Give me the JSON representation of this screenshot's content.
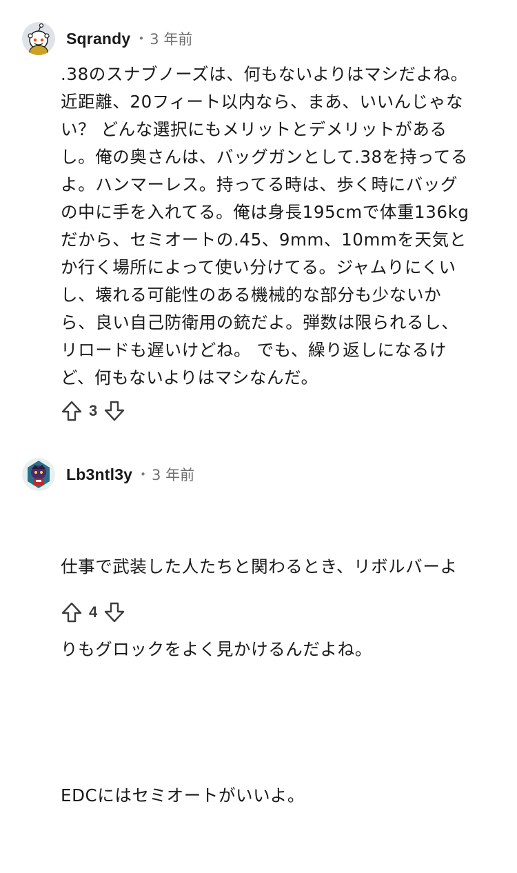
{
  "comments": [
    {
      "username": "Sqrandy",
      "separator": "•",
      "time": "3 年前",
      "avatar_icon": "snoo-avatar-icon",
      "lines": [
        ".38のスナブノーズは、何もないよりはマシだよね。",
        "近距離、20フィート以内なら、まあ、いいんじゃな",
        "い？ どんな選択にもメリットとデメリットがある",
        "し。俺の奥さんは、バッグガンとして.38を持ってる",
        "よ。ハンマーレス。持ってる時は、歩く時にバッグ",
        "の中に手を入れてる。俺は身長195cmで体重136kg",
        "だから、セミオートの.45、9mm、10mmを天気と",
        "か行く場所によって使い分けてる。ジャムりにくい",
        "し、壊れる可能性のある機械的な部分も少ないか",
        "ら、良い自己防衛用の銃だよ。弾数は限られるし、",
        "リロードも遅いけどね。 でも、繰り返しになるけ",
        "ど、何もないよりはマシなんだ。"
      ],
      "score": "3",
      "upvote_icon": "upvote-arrow-icon",
      "downvote_icon": "downvote-arrow-icon"
    },
    {
      "username": "Lb3ntl3y",
      "separator": "•",
      "time": "3 年前",
      "avatar_icon": "character-avatar-icon",
      "paragraphs": [
        [
          "仕事で武装した人たちと関わるとき、リボルバーよ",
          "りもグロックをよく見かけるんだよね。"
        ],
        [
          "EDCにはセミオートがいいよ。"
        ]
      ],
      "score": "4",
      "upvote_icon": "upvote-arrow-icon",
      "downvote_icon": "downvote-arrow-icon"
    }
  ],
  "colors": {
    "text": "#1a1a1b",
    "meta": "#6f6f6f",
    "icon": "#3c3c3c",
    "background": "#ffffff"
  }
}
